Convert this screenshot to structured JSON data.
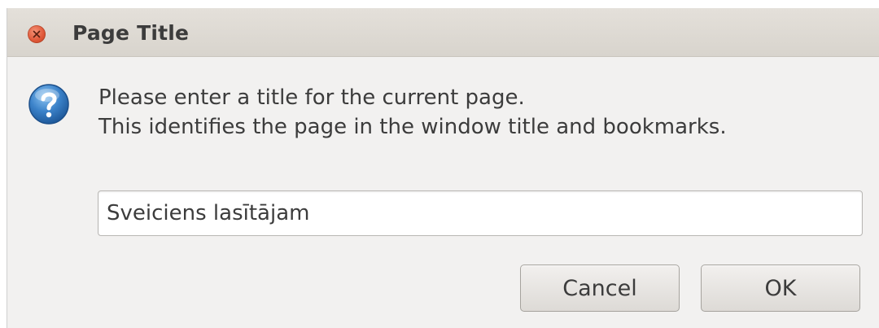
{
  "window": {
    "title": "Page Title"
  },
  "message": {
    "line1": "Please enter a title for the current page.",
    "line2": "This identifies the page in the window title and bookmarks."
  },
  "input": {
    "value": "Sveiciens lasītājam"
  },
  "buttons": {
    "cancel": "Cancel",
    "ok": "OK"
  },
  "icons": {
    "close": "close-icon",
    "dialog": "question-icon"
  },
  "colors": {
    "close_button": "#e0593a",
    "question_icon": "#3b82c9",
    "dialog_background": "#f2f1f0"
  }
}
